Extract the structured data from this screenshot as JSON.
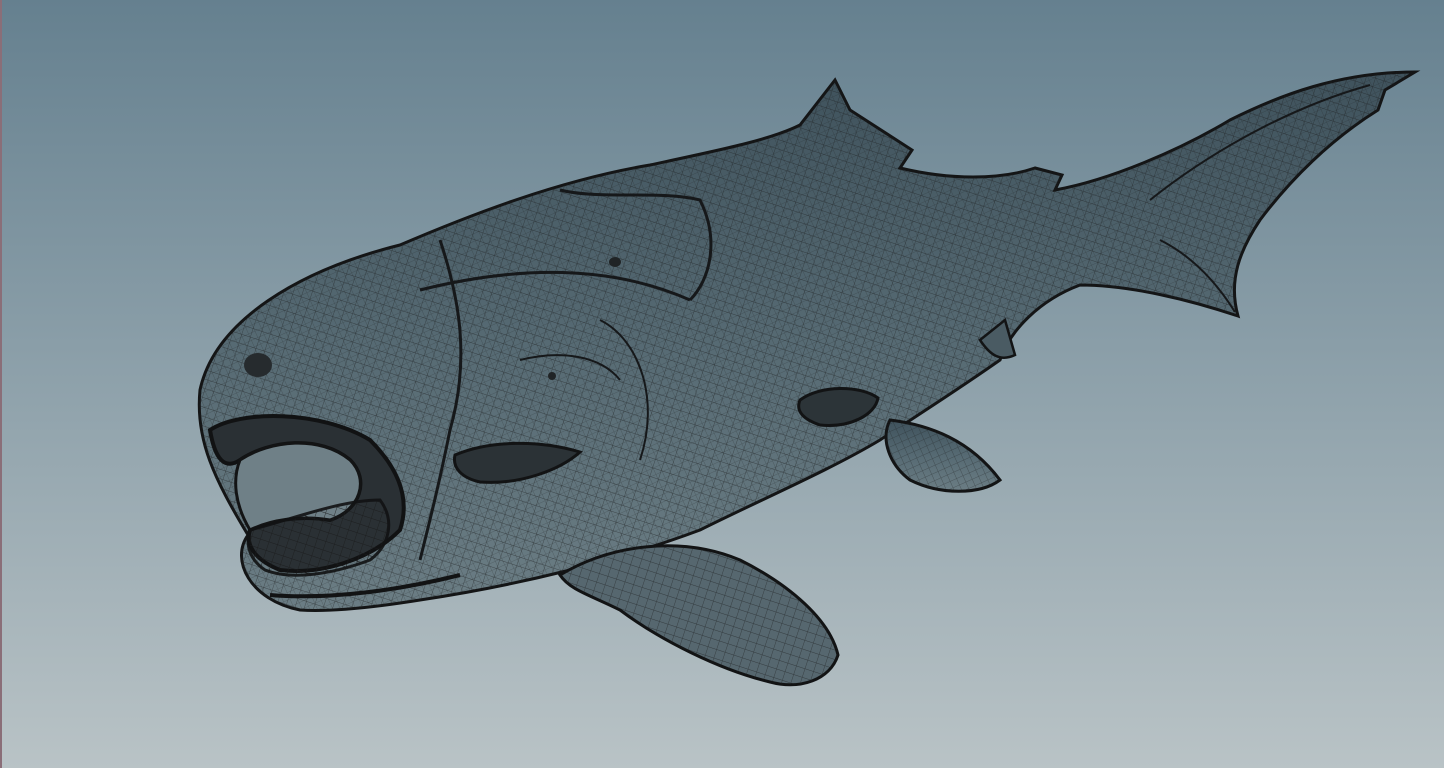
{
  "viewport": {
    "background_top": "#65808f",
    "background_bottom": "#b9c3c6",
    "edge_color": "#8a6e78"
  },
  "model": {
    "display_mode": "wireframe",
    "subject": "fish",
    "wire_color": "#1c1d1e",
    "body_shade": "#4e6069"
  }
}
